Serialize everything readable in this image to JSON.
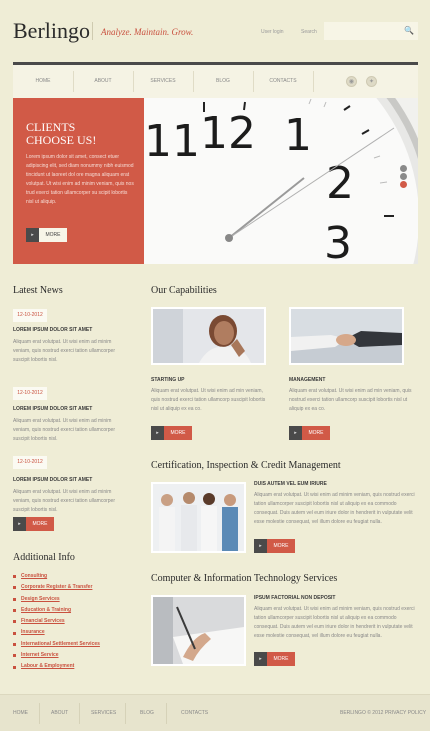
{
  "header": {
    "logo": "Berlingo",
    "tagline": "Analyze. Maintain. Grow.",
    "user_login": "User login",
    "search_label": "Search"
  },
  "nav": {
    "items": [
      "Home",
      "About",
      "Services",
      "Blog",
      "Contacts"
    ]
  },
  "hero": {
    "title_line1": "CLIENTS",
    "title_line2": "CHOOSE US!",
    "text": "Lorem ipsum dolor sit amet, consect etuer adipiscing elit, sed diam nonummy nibh euismod tincidunt ut laoreet dol ore magna aliquam erat volutpat. Ut wisi enim ad minim veniam, quis nos trud exerci tation ullamcorper su scipit lobortis nisl ut aliquip.",
    "button": "More",
    "clock_numerals": [
      "11",
      "12",
      "1",
      "2",
      "3"
    ]
  },
  "latest_news": {
    "heading": "Latest News",
    "items": [
      {
        "date": "12-10-2012",
        "title": "Lorem ipsum dolor sit amet",
        "text": "Aliquam erat volutpat. Ut wisi enim ad minim veniam, quis nostrud exerci tation ullamcorper suscipit lobortis nisl."
      },
      {
        "date": "12-10-2012",
        "title": "Lorem ipsum dolor sit amet",
        "text": "Aliquam erat volutpat. Ut wisi enim ad minim veniam, quis nostrud exerci tation ullamcorper suscipit lobortis nisl."
      },
      {
        "date": "12-10-2012",
        "title": "Lorem ipsum dolor sit amet",
        "text": "Aliquam erat volutpat. Ut wisi enim ad minim veniam, quis nostrud exerci tation ullamcorper suscipit lobortis nisl."
      }
    ],
    "button": "More"
  },
  "additional_info": {
    "heading": "Additional Info",
    "items": [
      "Consulting",
      "Corporate Register & Transfer",
      "Design Services",
      "Education & Training",
      "Financial Services",
      "Insurance",
      "International Settlement Services",
      "Internet Service",
      "Labour & Employment"
    ]
  },
  "capabilities": {
    "heading": "Our Capabilities",
    "items": [
      {
        "title": "Starting up",
        "text": "Aliquam erat volutpat. Ut wisi enim ad min veniam, quis nostrud exerci tation ullamcorp suscipit lobortis nisl ut aliquip ex ea co.",
        "button": "More"
      },
      {
        "title": "Management",
        "text": "Aliquam erat volutpat. Ut wisi enim ad min veniam, quis nostrud exerci tation ullamcorp suscipit lobortis nisl ut aliquip ex ea co.",
        "button": "More"
      }
    ]
  },
  "certification": {
    "heading": "Certification, Inspection & Credit Management",
    "subtitle": "Duis autem vel eum iriure",
    "text": "Aliquam erat volutpat. Ut wisi enim ad minim veniam, quis nostrud exerci tation ullamcorper suscipit lobortis nisl ut aliquip ex ea commodo consequat. Duis autem vel eum iriure dolor in hendrerit in vulputate velit esse molestie consequat, vel illum dolore eu feugiat nulla.",
    "button": "More"
  },
  "computer_services": {
    "heading": "Computer & Information Technology Services",
    "subtitle": "Ipsum factorial non deposit",
    "text": "Aliquam erat volutpat. Ut wisi enim ad minim veniam, quis nostrud exerci tation ullamcorper suscipit lobortis nisl ut aliquip ex ea commodo consequat. Duis autem vel eum iriure dolor in hendrerit in vulputate velit esse molestie consequat, vel illum dolore eu feugiat nulla.",
    "button": "More"
  },
  "footer": {
    "items": [
      "Home",
      "About",
      "Services",
      "Blog",
      "Contacts"
    ],
    "copyright": "BERLINGO © 2012 PRIVACY POLICY"
  },
  "colors": {
    "accent": "#d15a47",
    "background": "#efedd6",
    "dark": "#4a4a4a"
  }
}
